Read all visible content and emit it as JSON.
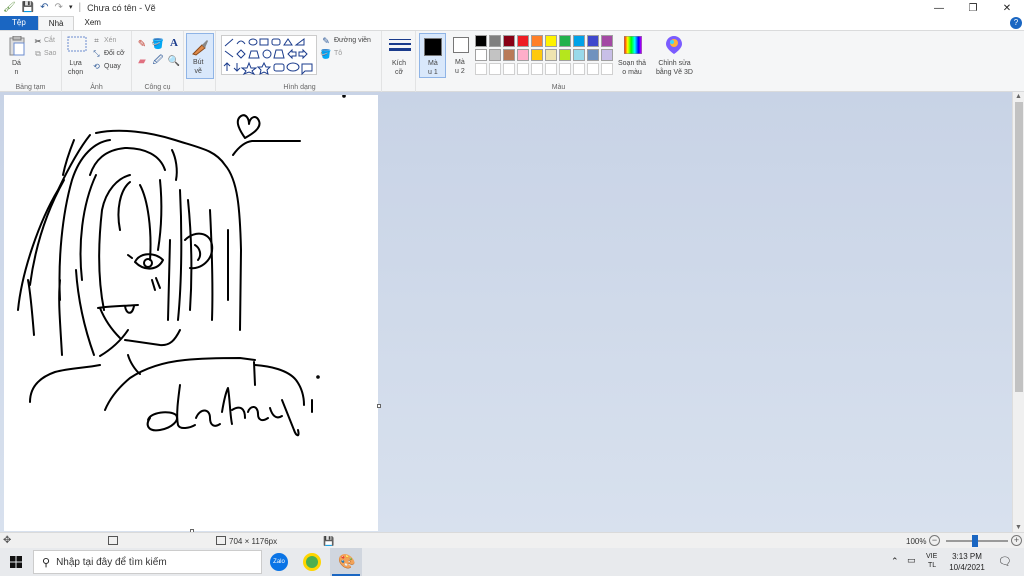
{
  "window": {
    "title": "Chưa có tên - Vẽ"
  },
  "tabs": {
    "file": "Tệp",
    "home": "Nhà",
    "view": "Xem"
  },
  "ribbon": {
    "clipboard": {
      "label": "Bảng tạm",
      "paste": "Dá\nn",
      "cut": "Cắt",
      "copy": "Sao"
    },
    "image": {
      "label": "Ảnh",
      "select": "Lựa\nchọn",
      "crop": "Xén",
      "resize": "Đổi cỡ",
      "rotate": "Quay"
    },
    "tools": {
      "label": "Công cụ"
    },
    "brushes": {
      "label": "Bút\nvẽ"
    },
    "shapes": {
      "label": "Hình dạng",
      "outline": "Đường viền",
      "fill": "Tô"
    },
    "size": {
      "label": "Kích\ncỡ"
    },
    "colors": {
      "label": "Màu",
      "color1": "Mà\nu 1",
      "color2": "Mà\nu 2",
      "edit_colors": "Soạn thả\no màu",
      "edit_3d": "Chỉnh sửa\nbằng Vẽ 3D",
      "palette_row1": [
        "#000000",
        "#7f7f7f",
        "#880015",
        "#ed1c24",
        "#ff7f27",
        "#fff200",
        "#22b14c",
        "#00a2e8",
        "#3f48cc",
        "#a349a4"
      ],
      "palette_row2": [
        "#ffffff",
        "#c3c3c3",
        "#b97a57",
        "#ffaec9",
        "#ffc90e",
        "#efe4b0",
        "#b5e61d",
        "#99d9ea",
        "#7092be",
        "#c8bfe7"
      ]
    }
  },
  "statusbar": {
    "canvas_size": "704 × 1176px",
    "zoom": "100%"
  },
  "taskbar": {
    "search_placeholder": "Nhập tại đây để tìm kiếm",
    "lang_line1": "VIE",
    "lang_line2": "TL",
    "time": "3:13 PM",
    "date": "10/4/2021"
  },
  "accent_color": "#1a66c2"
}
